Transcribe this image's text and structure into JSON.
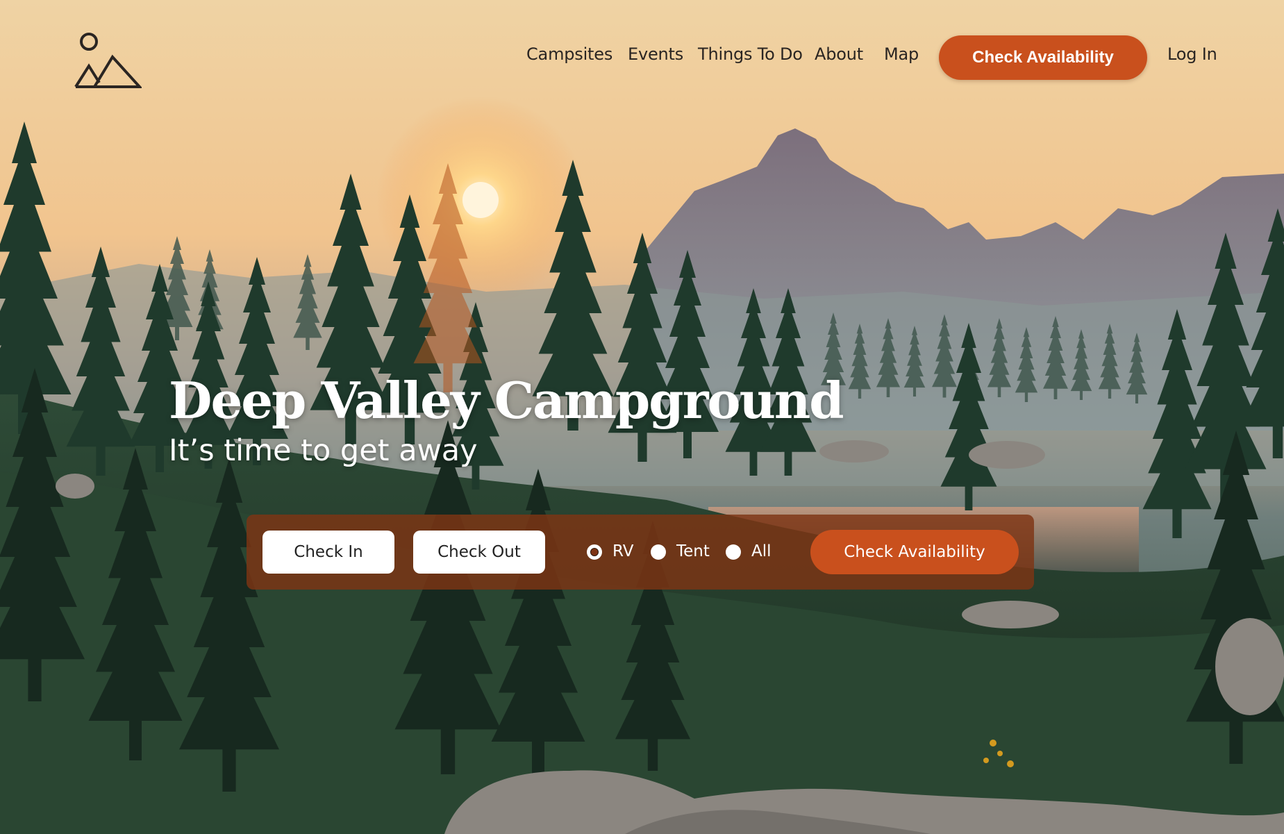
{
  "brand": {
    "logo_icon": "mountain-sun-logo-icon"
  },
  "nav": {
    "links": [
      {
        "label": "Campsites"
      },
      {
        "label": "Events"
      },
      {
        "label": "Things To Do"
      },
      {
        "label": "About"
      },
      {
        "label": "Map"
      }
    ],
    "cta_label": "Check Availability",
    "login_label": "Log In"
  },
  "hero": {
    "title": "Deep Valley Campground",
    "subtitle": "It’s time to get away"
  },
  "booking": {
    "check_in_label": "Check In",
    "check_out_label": "Check Out",
    "site_types": [
      {
        "label": "RV",
        "selected": true
      },
      {
        "label": "Tent",
        "selected": false
      },
      {
        "label": "All",
        "selected": false
      }
    ],
    "cta_label": "Check Availability"
  },
  "colors": {
    "accent": "#c9501d",
    "booking_bar": "#7e3414",
    "nav_text": "#2a2522"
  }
}
